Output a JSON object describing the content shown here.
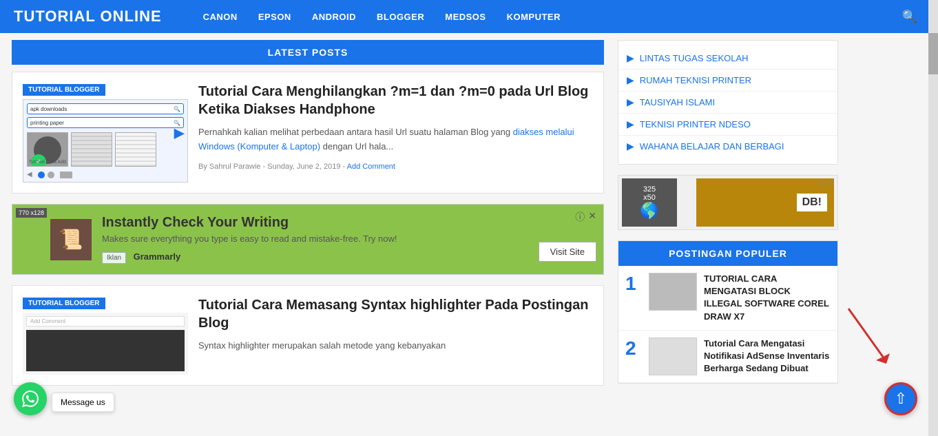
{
  "header": {
    "title": "TUTORIAL ONLINE",
    "nav": [
      {
        "label": "CANON",
        "href": "#"
      },
      {
        "label": "EPSON",
        "href": "#"
      },
      {
        "label": "ANDROID",
        "href": "#"
      },
      {
        "label": "BLOGGER",
        "href": "#"
      },
      {
        "label": "MEDSOS",
        "href": "#"
      },
      {
        "label": "KOMPUTER",
        "href": "#"
      }
    ]
  },
  "main": {
    "latest_posts_label": "LATEST POSTS",
    "posts": [
      {
        "badge": "TUTORIAL BLOGGER",
        "title": "Tutorial Cara Menghilangkan ?m=1 dan ?m=0 pada Url Blog Ketika Diakses Handphone",
        "excerpt": "Pernahkah kalian melihat perbedaan antara hasil Url suatu halaman Blog yang diakses melalui Windows (Komputer & Laptop) dengan Url hala...",
        "author": "Sahrul Parawie",
        "date": "Sunday, June 2, 2019",
        "comment": "Add Comment",
        "search_text1": "apk downloads",
        "search_text2": "printing paper"
      },
      {
        "badge": "TUTORIAL BLOGGER",
        "title": "Tutorial Cara Memasang Syntax highlighter Pada Postingan Blog",
        "excerpt": "Syntax highlighter merupakan salah metode yang kebanyakan",
        "author": "",
        "date": "",
        "comment": ""
      }
    ],
    "ad": {
      "size": "770 x128",
      "title": "Instantly Check Your Writing",
      "subtitle": "Makes sure everything you type is easy to read and mistake-free. Try now!",
      "badge_label": "Iklan",
      "brand": "Grammarly",
      "visit_btn": "Visit Site"
    }
  },
  "sidebar": {
    "links": [
      {
        "label": "LINTAS TUGAS SEKOLAH"
      },
      {
        "label": "RUMAH TEKNISI PRINTER"
      },
      {
        "label": "TAUSIYAH ISLAMI"
      },
      {
        "label": "TEKNISI PRINTER NDESO"
      },
      {
        "label": "WAHANA BELAJAR DAN BERBAGI"
      }
    ],
    "popular_header": "POSTINGAN POPULER",
    "popular_items": [
      {
        "number": "1",
        "title": "TUTORIAL CARA MENGATASI BLOCK ILLEGAL SOFTWARE COREL DRAW X7"
      },
      {
        "number": "2",
        "title": "Tutorial Cara Mengatasi Notifikasi AdSense Inventaris Berharga Sedang Dibuat"
      }
    ]
  },
  "floating": {
    "whatsapp_message": "Message us",
    "scroll_top_label": "↑"
  }
}
